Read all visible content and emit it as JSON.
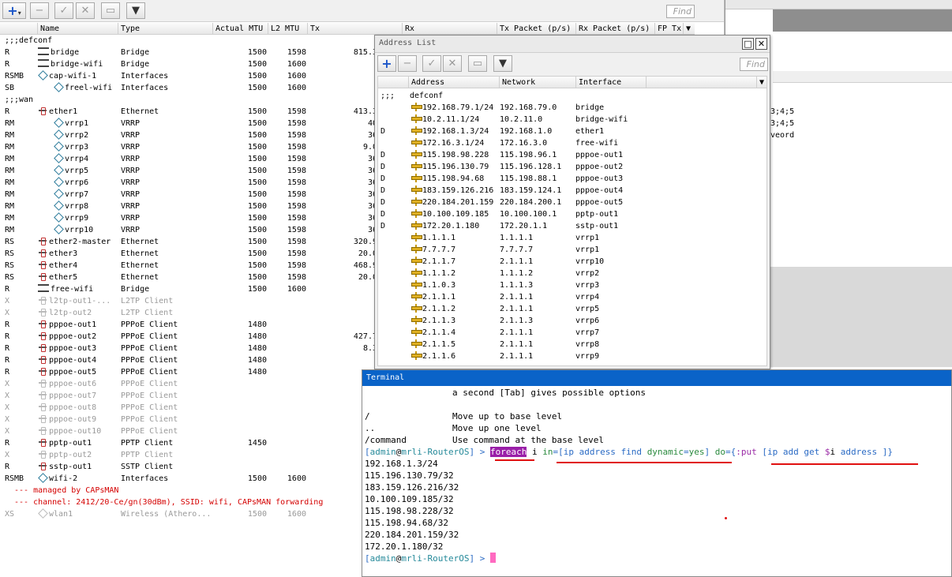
{
  "iface": {
    "find": "Find",
    "headers": {
      "name": "Name",
      "type": "Type",
      "actual_mtu": "Actual MTU",
      "l2_mtu": "L2 MTU",
      "tx": "Tx",
      "rx": "Rx",
      "tx_packet": "Tx Packet (p/s)",
      "rx_packet": "Rx Packet (p/s)",
      "fp_tx": "FP Tx"
    },
    "rows": [
      {
        "flag": ";;;",
        "name": "defconf",
        "type": "",
        "amtu": "",
        "l2": "",
        "tx": "",
        "kind": "comment"
      },
      {
        "flag": "R",
        "name": "bridge",
        "type": "Bridge",
        "amtu": "1500",
        "l2": "1598",
        "tx": "815.3",
        "kind": "br"
      },
      {
        "flag": "R",
        "name": "bridge-wifi",
        "type": "Bridge",
        "amtu": "1500",
        "l2": "1600",
        "tx": "",
        "kind": "br"
      },
      {
        "flag": "RSMB",
        "name": "cap-wifi-1",
        "type": "Interfaces",
        "amtu": "1500",
        "l2": "1600",
        "tx": "",
        "kind": "vr"
      },
      {
        "flag": "SB",
        "name": "freel-wifi",
        "type": "Interfaces",
        "amtu": "1500",
        "l2": "1600",
        "tx": "",
        "kind": "vr2"
      },
      {
        "flag": ";;;",
        "name": "wan",
        "type": "",
        "amtu": "",
        "l2": "",
        "tx": "",
        "kind": "comment"
      },
      {
        "flag": "R",
        "name": "ether1",
        "type": "Ethernet",
        "amtu": "1500",
        "l2": "1598",
        "tx": "413.3",
        "kind": "if"
      },
      {
        "flag": "RM",
        "name": "vrrp1",
        "type": "VRRP",
        "amtu": "1500",
        "l2": "1598",
        "tx": "40",
        "kind": "vr2"
      },
      {
        "flag": "RM",
        "name": "vrrp2",
        "type": "VRRP",
        "amtu": "1500",
        "l2": "1598",
        "tx": "36",
        "kind": "vr2"
      },
      {
        "flag": "RM",
        "name": "vrrp3",
        "type": "VRRP",
        "amtu": "1500",
        "l2": "1598",
        "tx": "9.0",
        "kind": "vr2"
      },
      {
        "flag": "RM",
        "name": "vrrp4",
        "type": "VRRP",
        "amtu": "1500",
        "l2": "1598",
        "tx": "36",
        "kind": "vr2"
      },
      {
        "flag": "RM",
        "name": "vrrp5",
        "type": "VRRP",
        "amtu": "1500",
        "l2": "1598",
        "tx": "36",
        "kind": "vr2"
      },
      {
        "flag": "RM",
        "name": "vrrp6",
        "type": "VRRP",
        "amtu": "1500",
        "l2": "1598",
        "tx": "36",
        "kind": "vr2"
      },
      {
        "flag": "RM",
        "name": "vrrp7",
        "type": "VRRP",
        "amtu": "1500",
        "l2": "1598",
        "tx": "36",
        "kind": "vr2"
      },
      {
        "flag": "RM",
        "name": "vrrp8",
        "type": "VRRP",
        "amtu": "1500",
        "l2": "1598",
        "tx": "36",
        "kind": "vr2"
      },
      {
        "flag": "RM",
        "name": "vrrp9",
        "type": "VRRP",
        "amtu": "1500",
        "l2": "1598",
        "tx": "36",
        "kind": "vr2"
      },
      {
        "flag": "RM",
        "name": "vrrp10",
        "type": "VRRP",
        "amtu": "1500",
        "l2": "1598",
        "tx": "36",
        "kind": "vr2"
      },
      {
        "flag": "RS",
        "name": "ether2-master",
        "type": "Ethernet",
        "amtu": "1500",
        "l2": "1598",
        "tx": "320.9",
        "kind": "if"
      },
      {
        "flag": "RS",
        "name": "ether3",
        "type": "Ethernet",
        "amtu": "1500",
        "l2": "1598",
        "tx": "20.0",
        "kind": "if"
      },
      {
        "flag": "RS",
        "name": "ether4",
        "type": "Ethernet",
        "amtu": "1500",
        "l2": "1598",
        "tx": "468.9",
        "kind": "if"
      },
      {
        "flag": "RS",
        "name": "ether5",
        "type": "Ethernet",
        "amtu": "1500",
        "l2": "1598",
        "tx": "20.0",
        "kind": "if"
      },
      {
        "flag": "R",
        "name": "free-wifi",
        "type": "Bridge",
        "amtu": "1500",
        "l2": "1600",
        "tx": "",
        "kind": "br"
      },
      {
        "flag": "X",
        "name": "l2tp-out1-...",
        "type": "L2TP Client",
        "amtu": "",
        "l2": "",
        "tx": "",
        "kind": "if",
        "dis": true
      },
      {
        "flag": "X",
        "name": "l2tp-out2",
        "type": "L2TP Client",
        "amtu": "",
        "l2": "",
        "tx": "",
        "kind": "if",
        "dis": true
      },
      {
        "flag": "R",
        "name": "pppoe-out1",
        "type": "PPPoE Client",
        "amtu": "1480",
        "l2": "",
        "tx": "",
        "kind": "if"
      },
      {
        "flag": "R",
        "name": "pppoe-out2",
        "type": "PPPoE Client",
        "amtu": "1480",
        "l2": "",
        "tx": "427.7",
        "kind": "if"
      },
      {
        "flag": "R",
        "name": "pppoe-out3",
        "type": "PPPoE Client",
        "amtu": "1480",
        "l2": "",
        "tx": "8.3",
        "kind": "if"
      },
      {
        "flag": "R",
        "name": "pppoe-out4",
        "type": "PPPoE Client",
        "amtu": "1480",
        "l2": "",
        "tx": "",
        "kind": "if"
      },
      {
        "flag": "R",
        "name": "pppoe-out5",
        "type": "PPPoE Client",
        "amtu": "1480",
        "l2": "",
        "tx": "",
        "kind": "if"
      },
      {
        "flag": "X",
        "name": "pppoe-out6",
        "type": "PPPoE Client",
        "amtu": "",
        "l2": "",
        "tx": "",
        "kind": "if",
        "dis": true
      },
      {
        "flag": "X",
        "name": "pppoe-out7",
        "type": "PPPoE Client",
        "amtu": "",
        "l2": "",
        "tx": "",
        "kind": "if",
        "dis": true
      },
      {
        "flag": "X",
        "name": "pppoe-out8",
        "type": "PPPoE Client",
        "amtu": "",
        "l2": "",
        "tx": "",
        "kind": "if",
        "dis": true
      },
      {
        "flag": "X",
        "name": "pppoe-out9",
        "type": "PPPoE Client",
        "amtu": "",
        "l2": "",
        "tx": "",
        "kind": "if",
        "dis": true
      },
      {
        "flag": "X",
        "name": "pppoe-out10",
        "type": "PPPoE Client",
        "amtu": "",
        "l2": "",
        "tx": "",
        "kind": "if",
        "dis": true
      },
      {
        "flag": "R",
        "name": "pptp-out1",
        "type": "PPTP Client",
        "amtu": "1450",
        "l2": "",
        "tx": "",
        "kind": "if"
      },
      {
        "flag": "X",
        "name": "pptp-out2",
        "type": "PPTP Client",
        "amtu": "",
        "l2": "",
        "tx": "",
        "kind": "if",
        "dis": true
      },
      {
        "flag": "R",
        "name": "sstp-out1",
        "type": "SSTP Client",
        "amtu": "",
        "l2": "",
        "tx": "",
        "kind": "if"
      },
      {
        "flag": "RSMB",
        "name": "wifi-2",
        "type": "Interfaces",
        "amtu": "1500",
        "l2": "1600",
        "tx": "",
        "kind": "vr"
      },
      {
        "flag": "",
        "name": "--- managed by CAPsMAN",
        "type": "",
        "amtu": "",
        "l2": "",
        "tx": "",
        "kind": "red"
      },
      {
        "flag": "",
        "name": "--- channel: 2412/20-Ce/gn(30dBm), SSID: wifi, CAPsMAN forwarding",
        "type": "",
        "amtu": "",
        "l2": "",
        "tx": "",
        "kind": "red"
      },
      {
        "flag": "XS",
        "name": "wlan1",
        "type": "Wireless (Athero...",
        "amtu": "1500",
        "l2": "1600",
        "tx": "",
        "kind": "vr",
        "dis": true
      }
    ]
  },
  "right_bg": {
    "text1": "3;4;5",
    "text2": "3;4;5",
    "text3": "veord"
  },
  "addr": {
    "title": "Address List",
    "find": "Find",
    "headers": {
      "address": "Address",
      "network": "Network",
      "interface": "Interface"
    },
    "rows": [
      {
        "flag": ";;;",
        "address": "defconf",
        "network": "",
        "iface": "",
        "kind": "comment"
      },
      {
        "flag": "",
        "address": "192.168.79.1/24",
        "network": "192.168.79.0",
        "iface": "bridge"
      },
      {
        "flag": "",
        "address": "10.2.11.1/24",
        "network": "10.2.11.0",
        "iface": "bridge-wifi"
      },
      {
        "flag": "D",
        "address": "192.168.1.3/24",
        "network": "192.168.1.0",
        "iface": "ether1"
      },
      {
        "flag": "",
        "address": "172.16.3.1/24",
        "network": "172.16.3.0",
        "iface": "free-wifi"
      },
      {
        "flag": "D",
        "address": "115.198.98.228",
        "network": "115.198.96.1",
        "iface": "pppoe-out1"
      },
      {
        "flag": "D",
        "address": "115.196.130.79",
        "network": "115.196.128.1",
        "iface": "pppoe-out2"
      },
      {
        "flag": "D",
        "address": "115.198.94.68",
        "network": "115.198.88.1",
        "iface": "pppoe-out3"
      },
      {
        "flag": "D",
        "address": "183.159.126.216",
        "network": "183.159.124.1",
        "iface": "pppoe-out4"
      },
      {
        "flag": "D",
        "address": "220.184.201.159",
        "network": "220.184.200.1",
        "iface": "pppoe-out5"
      },
      {
        "flag": "D",
        "address": "10.100.109.185",
        "network": "10.100.100.1",
        "iface": "pptp-out1"
      },
      {
        "flag": "D",
        "address": "172.20.1.180",
        "network": "172.20.1.1",
        "iface": "sstp-out1"
      },
      {
        "flag": "",
        "address": "1.1.1.1",
        "network": "1.1.1.1",
        "iface": "vrrp1"
      },
      {
        "flag": "",
        "address": "7.7.7.7",
        "network": "7.7.7.7",
        "iface": "vrrp1"
      },
      {
        "flag": "",
        "address": "2.1.1.7",
        "network": "2.1.1.1",
        "iface": "vrrp10"
      },
      {
        "flag": "",
        "address": "1.1.1.2",
        "network": "1.1.1.2",
        "iface": "vrrp2"
      },
      {
        "flag": "",
        "address": "1.1.0.3",
        "network": "1.1.1.3",
        "iface": "vrrp3"
      },
      {
        "flag": "",
        "address": "2.1.1.1",
        "network": "2.1.1.1",
        "iface": "vrrp4"
      },
      {
        "flag": "",
        "address": "2.1.1.2",
        "network": "2.1.1.1",
        "iface": "vrrp5"
      },
      {
        "flag": "",
        "address": "2.1.1.3",
        "network": "2.1.1.3",
        "iface": "vrrp6"
      },
      {
        "flag": "",
        "address": "2.1.1.4",
        "network": "2.1.1.1",
        "iface": "vrrp7"
      },
      {
        "flag": "",
        "address": "2.1.1.5",
        "network": "2.1.1.1",
        "iface": "vrrp8"
      },
      {
        "flag": "",
        "address": "2.1.1.6",
        "network": "2.1.1.1",
        "iface": "vrrp9"
      }
    ]
  },
  "terminal": {
    "title": "Terminal",
    "help_lines": [
      {
        "a": "",
        "b": "a second [Tab] gives possible options"
      },
      {
        "a": "",
        "b": ""
      },
      {
        "a": "/",
        "b": "Move up to base level"
      },
      {
        "a": "..",
        "b": "Move up one level"
      },
      {
        "a": "/command",
        "b": "Use command at the base level"
      }
    ],
    "prompt": {
      "open": "[",
      "user": "admin",
      "at": "@",
      "host": "mrli-RouterOS",
      "close": "] > "
    },
    "command": {
      "kw_foreach": "foreach",
      "var_i": " i ",
      "kw_in": "in",
      "eq1": "=[",
      "kw_ip": "ip",
      "kw_address": " address ",
      "kw_find": "find ",
      "kw_dynamic": "dynamic",
      "eq2": "=",
      "kw_yes": "yes",
      "close1": "] ",
      "kw_do": "do",
      "eq3": "={",
      "kw_put": ":put",
      "sp1": " [",
      "kw_ip2": "ip",
      "kw_add": " add ",
      "kw_get": "get ",
      "dollar": "$",
      "var_i2": "i",
      "tail": " address ]}"
    },
    "output": [
      "192.168.1.3/24",
      "115.196.130.79/32",
      "183.159.126.216/32",
      "10.100.109.185/32",
      "115.198.98.228/32",
      "115.198.94.68/32",
      "220.184.201.159/32",
      "172.20.1.180/32"
    ]
  }
}
